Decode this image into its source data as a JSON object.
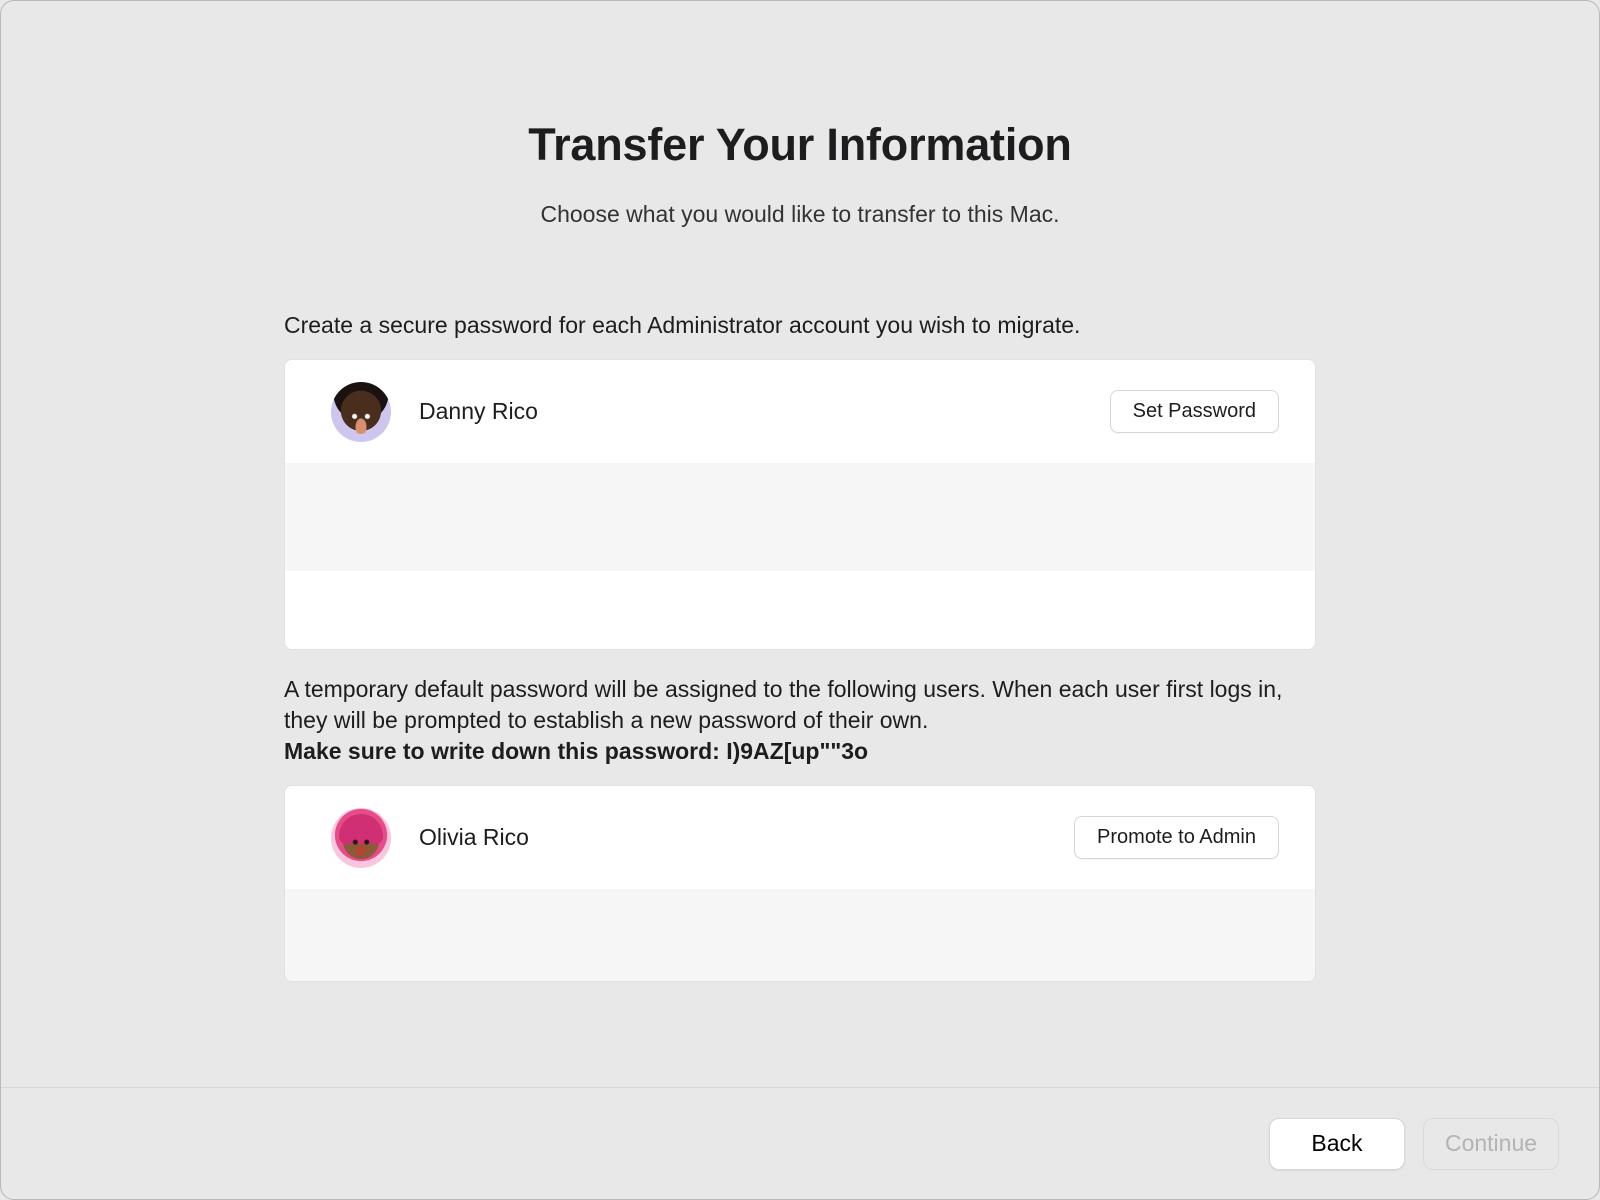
{
  "header": {
    "title": "Transfer Your Information",
    "subtitle": "Choose what you would like to transfer to this Mac."
  },
  "admin_section": {
    "instruction": "Create a secure password for each Administrator account you wish to migrate.",
    "users": [
      {
        "name": "Danny Rico",
        "button_label": "Set Password",
        "avatar": "danny"
      }
    ]
  },
  "standard_section": {
    "instruction_line1": "A temporary default password will be assigned to the following users. When each user first logs in, they will be prompted to establish a new password of their own.",
    "instruction_bold": "Make sure to write down this password: I)9AZ[up\"\"3o",
    "users": [
      {
        "name": "Olivia Rico",
        "button_label": "Promote to Admin",
        "avatar": "olivia"
      }
    ]
  },
  "footer": {
    "back_label": "Back",
    "continue_label": "Continue",
    "continue_enabled": false
  }
}
